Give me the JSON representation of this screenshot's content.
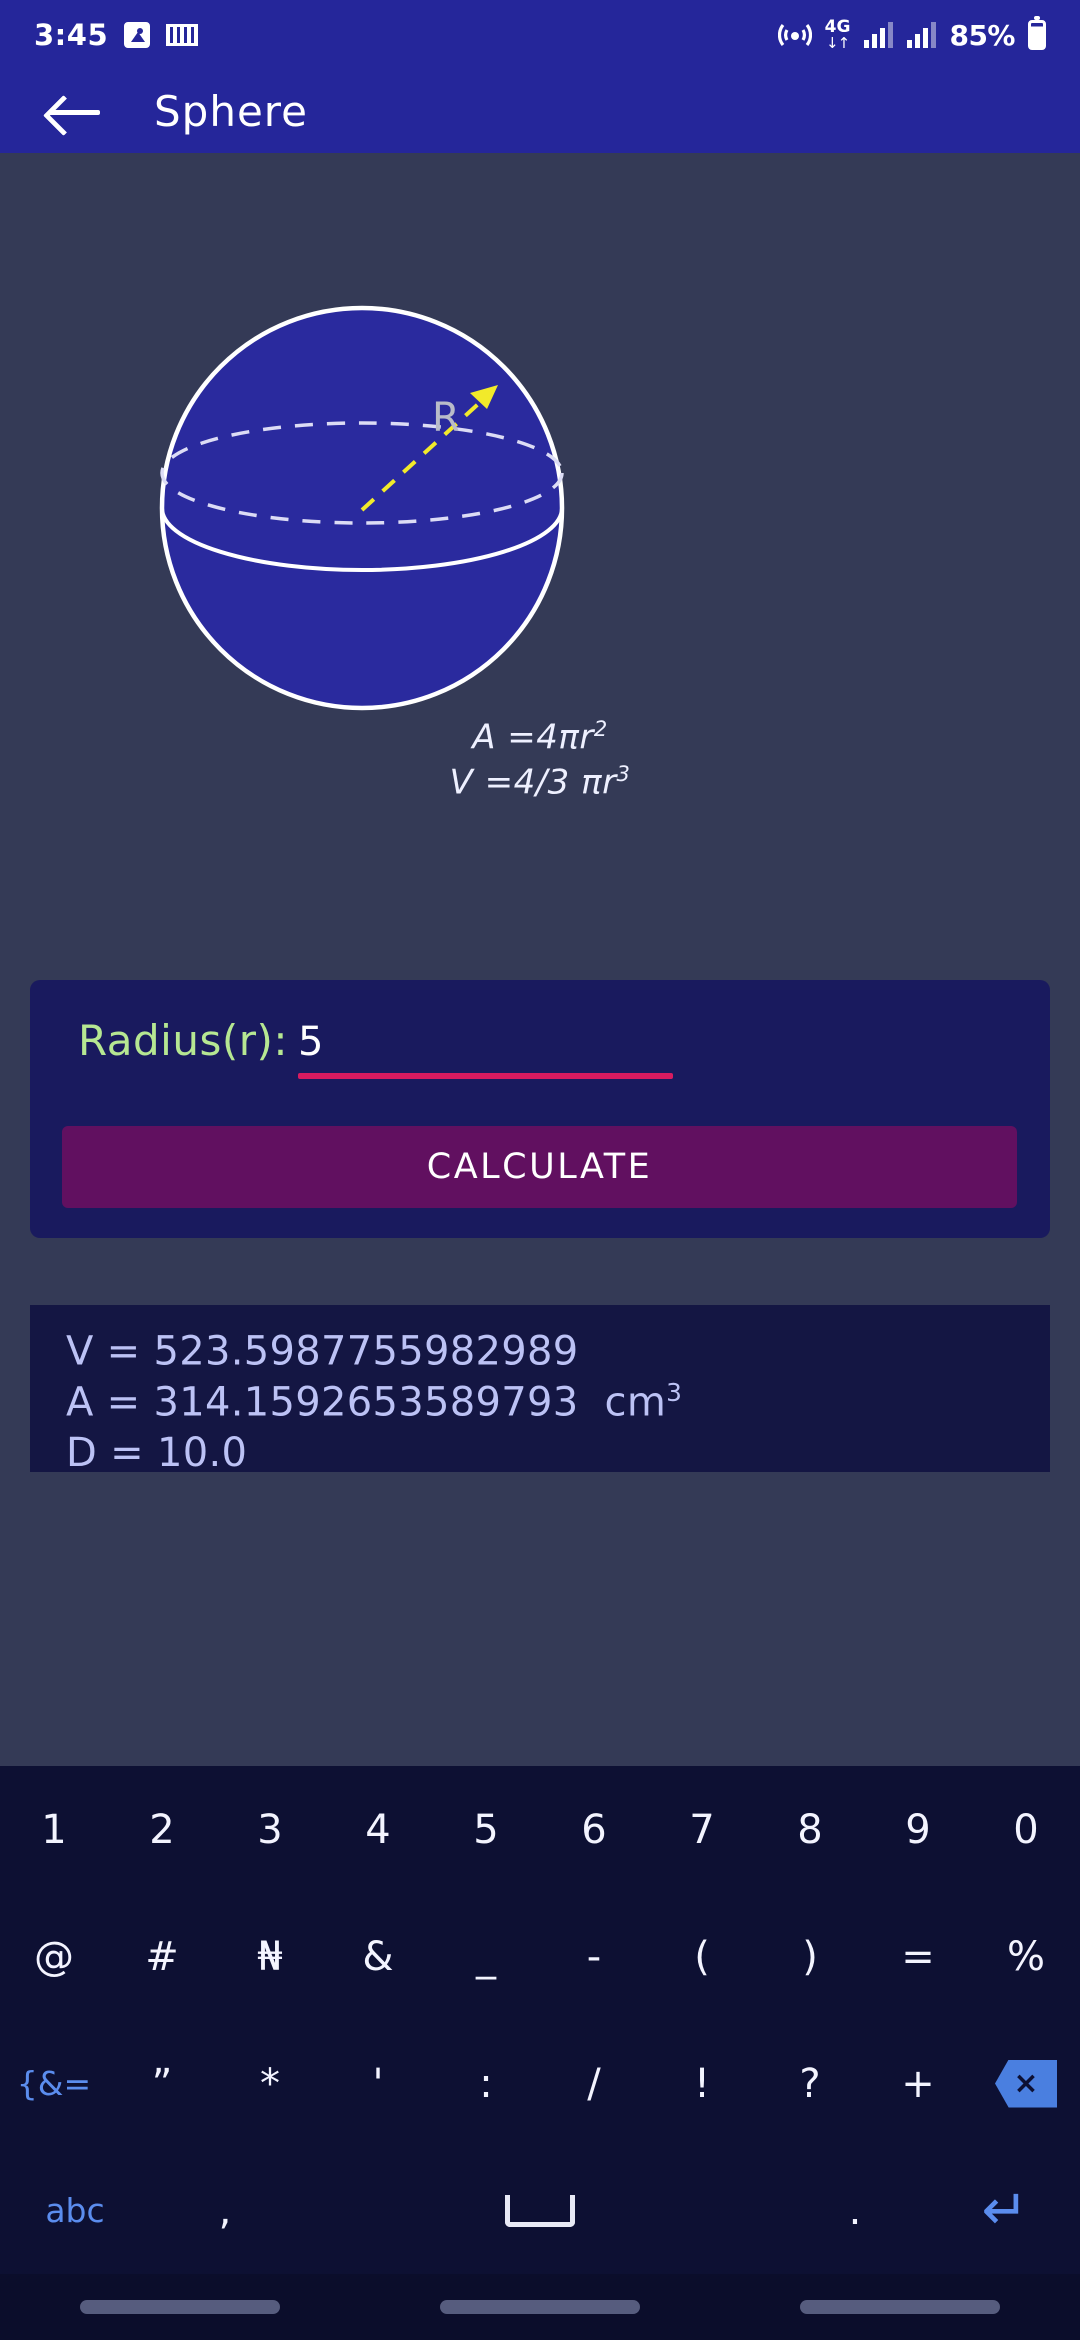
{
  "status_bar": {
    "time": "3:45",
    "left_icons": [
      "image-icon",
      "keyboard-icon"
    ],
    "network_label": "4G",
    "network_arrows": "↓↑",
    "battery_percent": "85%",
    "right_icons": [
      "hotspot-icon",
      "signal-bars-1",
      "signal-bars-2",
      "battery-icon"
    ]
  },
  "app_bar": {
    "back_icon": "back-arrow-icon",
    "title": "Sphere",
    "background": "#25269a"
  },
  "figure": {
    "shape": "sphere",
    "fill_color": "#2a2a9e",
    "outline_color": "#ffffff",
    "radius_label": "R",
    "radius_arrow_color": "#f2ea2a",
    "formula_area": "A  =4πr",
    "formula_area_exp": "2",
    "formula_volume": "V  =4/3 πr",
    "formula_volume_exp": "3"
  },
  "input_card": {
    "label": "Radius(r):",
    "label_color": "#b6e792",
    "value": "5",
    "placeholder": "",
    "underline_color": "#d81b60",
    "button_label": "CALCULATE",
    "button_color": "#611060",
    "card_color": "#191a5e"
  },
  "results": {
    "background": "#141643",
    "text_color": "#bcc2f5",
    "lines": [
      {
        "prefix": "V = ",
        "value": "523.5987755982989",
        "unit": "",
        "unit_exp": ""
      },
      {
        "prefix": "A = ",
        "value": "314.1592653589793",
        "unit": "  cm",
        "unit_exp": "3"
      },
      {
        "prefix": "D = ",
        "value": "10.0",
        "unit": "",
        "unit_exp": ""
      }
    ]
  },
  "keyboard": {
    "background": "#0d1033",
    "rows": [
      {
        "keys": [
          {
            "label": "1",
            "style": ""
          },
          {
            "label": "2",
            "style": ""
          },
          {
            "label": "3",
            "style": ""
          },
          {
            "label": "4",
            "style": ""
          },
          {
            "label": "5",
            "style": ""
          },
          {
            "label": "6",
            "style": ""
          },
          {
            "label": "7",
            "style": ""
          },
          {
            "label": "8",
            "style": ""
          },
          {
            "label": "9",
            "style": ""
          },
          {
            "label": "0",
            "style": ""
          }
        ]
      },
      {
        "keys": [
          {
            "label": "@",
            "style": ""
          },
          {
            "label": "#",
            "style": ""
          },
          {
            "label": "₦",
            "style": ""
          },
          {
            "label": "&",
            "style": ""
          },
          {
            "label": "_",
            "style": ""
          },
          {
            "label": "-",
            "style": ""
          },
          {
            "label": "(",
            "style": ""
          },
          {
            "label": ")",
            "style": ""
          },
          {
            "label": "=",
            "style": ""
          },
          {
            "label": "%",
            "style": ""
          }
        ]
      },
      {
        "keys": [
          {
            "label": "{&=",
            "style": "blue small"
          },
          {
            "label": "”",
            "style": ""
          },
          {
            "label": "*",
            "style": ""
          },
          {
            "label": "'",
            "style": ""
          },
          {
            "label": ":",
            "style": ""
          },
          {
            "label": "/",
            "style": ""
          },
          {
            "label": "!",
            "style": ""
          },
          {
            "label": "?",
            "style": ""
          },
          {
            "label": "+",
            "style": ""
          },
          {
            "label": "backspace-icon",
            "style": "icon-backspace"
          }
        ]
      },
      {
        "keys": [
          {
            "label": "abc",
            "style": "blue small"
          },
          {
            "label": ",",
            "style": ""
          },
          {
            "label": "space-key",
            "style": "icon-space"
          },
          {
            "label": ".",
            "style": ""
          },
          {
            "label": "enter-icon",
            "style": "icon-enter"
          }
        ]
      }
    ]
  },
  "nav_bar": {
    "pills": 3,
    "pill_color": "#565c7e"
  }
}
